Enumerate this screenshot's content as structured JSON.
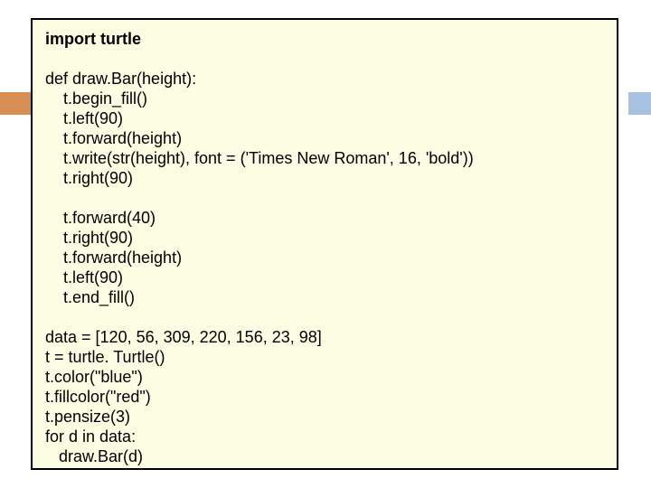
{
  "code": {
    "line1": "import turtle",
    "line2": "",
    "line3": "def draw.Bar(height):",
    "line4": "    t.begin_fill()",
    "line5": "    t.left(90)",
    "line6": "    t.forward(height)",
    "line7": "    t.write(str(height), font = ('Times New Roman', 16, 'bold'))",
    "line8": "    t.right(90)",
    "line9": "",
    "line10": "    t.forward(40)",
    "line11": "    t.right(90)",
    "line12": "    t.forward(height)",
    "line13": "    t.left(90)",
    "line14": "    t.end_fill()",
    "line15": "",
    "line16": "data = [120, 56, 309, 220, 156, 23, 98]",
    "line17": "t = turtle. Turtle()",
    "line18": "t.color(\"blue\")",
    "line19": "t.fillcolor(\"red\")",
    "line20": "t.pensize(3)",
    "line21": "for d in data:",
    "line22": "   draw.Bar(d)"
  }
}
